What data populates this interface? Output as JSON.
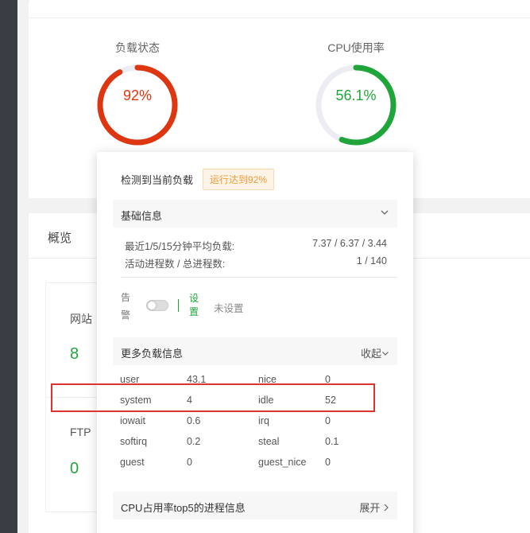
{
  "top_card": {
    "load": {
      "title": "负载状态",
      "value": "92%",
      "fraction": 0.92,
      "color": "#dd3611"
    },
    "cpu": {
      "title": "CPU使用率",
      "value": "56.1%",
      "fraction": 0.561,
      "color": "#20a53a"
    }
  },
  "overview": {
    "title": "概览",
    "tiles": [
      {
        "label": "网站",
        "value": "8"
      },
      {
        "label": "FTP",
        "value": "0"
      }
    ]
  },
  "popup": {
    "heading": "检测到当前负载",
    "badge": "运行达到92%",
    "basic_info": {
      "title": "基础信息",
      "rows": [
        {
          "key": "最近1/5/15分钟平均负载:",
          "value": "7.37 / 6.37 / 3.44"
        },
        {
          "key": "活动进程数 / 总进程数:",
          "value": "1 / 140"
        }
      ]
    },
    "alarm": {
      "label": "告警",
      "set_link": "设置",
      "status": "未设置"
    },
    "more_info": {
      "title": "更多负载信息",
      "toggle": "收起",
      "rows": [
        [
          "user",
          "43.1",
          "nice",
          "0"
        ],
        [
          "system",
          "4",
          "idle",
          "52"
        ],
        [
          "iowait",
          "0.6",
          "irq",
          "0"
        ],
        [
          "softirq",
          "0.2",
          "steal",
          "0.1"
        ],
        [
          "guest",
          "0",
          "guest_nice",
          "0"
        ]
      ]
    },
    "top5": {
      "title": "CPU占用率top5的进程信息",
      "toggle": "展开"
    }
  },
  "colors": {
    "accent_green": "#20a53a",
    "load_red": "#dd3611",
    "highlight_red": "#e03131",
    "badge_orange": "#f39c3c"
  }
}
